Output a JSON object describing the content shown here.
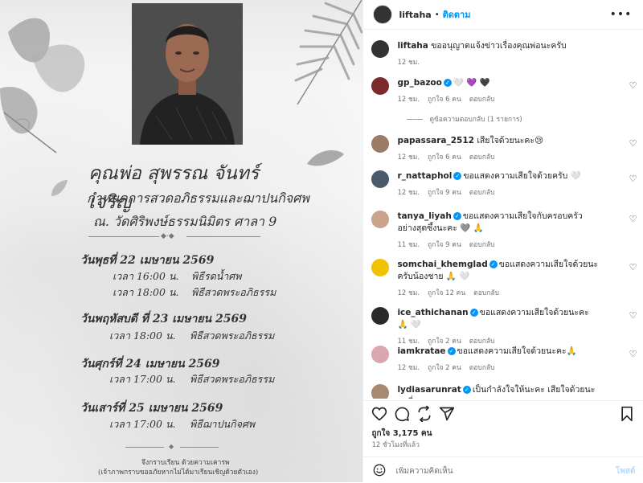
{
  "memorial": {
    "name": "คุณพ่อ สุพรรณ จันทร์เจริญ",
    "subtitle": "กำหนดการสวดอภิธรรมและฌาปนกิจศพ",
    "venue": "ณ. วัดศิริพงษ์ธรรมนิมิตร ศาลา 9",
    "schedule": [
      {
        "day": "วันพุธที่ 22 เมษายน 2569",
        "slots": [
          {
            "time": "เวลา 16:00 น.",
            "event": "พิธีรดน้ำศพ"
          },
          {
            "time": "เวลา 18:00 น.",
            "event": "พิธีสวดพระอภิธรรม"
          }
        ]
      },
      {
        "day": "วันพฤหัสบดี ที่ 23 เมษายน  2569",
        "slots": [
          {
            "time": "เวลา 18:00 น.",
            "event": "พิธีสวดพระอภิธรรม"
          }
        ]
      },
      {
        "day": "วันศุกร์ที่ 24 เมษายน 2569",
        "slots": [
          {
            "time": "เวลา 17:00 น.",
            "event": "พิธีสวดพระอภิธรรม"
          }
        ]
      },
      {
        "day": "วันเสาร์ที่ 25 เมษายน 2569",
        "slots": [
          {
            "time": "เวลา 17:00 น.",
            "event": "พิธีฌาปนกิจศพ"
          }
        ]
      }
    ],
    "closing_line1": "จึงกราบเรียน ด้วยความเคารพ",
    "closing_line2": "(เจ้าภาพกราบขออภัยหากไม่ได้มาเรียนเชิญด้วยตัวเอง)"
  },
  "header": {
    "username": "liftaha",
    "separator": "•",
    "follow_label": "ติดตาม",
    "more_label": "•••"
  },
  "caption": {
    "username": "liftaha",
    "text": "ขออนุญาตแจ้งข่าวเรื่องคุณพ่อนะครับ",
    "time": "12 ชม."
  },
  "comments": [
    {
      "username": "gp_bazoo",
      "verified": true,
      "text": "🤍 💜 🖤",
      "time": "12 ชม.",
      "likes": "ถูกใจ 6 คน",
      "reply": "ตอบกลับ",
      "avatar_color": "#7a2a2a"
    },
    {
      "username": "papassara_2512",
      "verified": false,
      "text": "เสียใจด้วยนะคะ😢",
      "time": "12 ชม.",
      "likes": "ถูกใจ 6 คน",
      "reply": "ตอบกลับ",
      "avatar_color": "#9b7b66"
    },
    {
      "username": "r_nattaphol",
      "verified": true,
      "text": "ขอแสดงความเสียใจด้วยครับ 🤍",
      "time": "12 ชม.",
      "likes": "ถูกใจ 9 คน",
      "reply": "ตอบกลับ",
      "avatar_color": "#4a5a6a"
    },
    {
      "username": "tanya_liyah",
      "verified": true,
      "text": "ขอแสดงความเสียใจกับครอบครัวอย่างสุดซึ้งนะคะ 🩶 🙏",
      "time": "11 ชม.",
      "likes": "ถูกใจ 9 คน",
      "reply": "ตอบกลับ",
      "avatar_color": "#c9a48a"
    },
    {
      "username": "somchai_khemglad",
      "verified": true,
      "text": "ขอแสดงความเสียใจด้วยนะครับน้องชาย 🙏 🤍",
      "time": "12 ชม.",
      "likes": "ถูกใจ 12 คน",
      "reply": "ตอบกลับ",
      "avatar_color": "#f2c200"
    },
    {
      "username": "ice_athichanan",
      "verified": true,
      "text": "ขอแสดงความเสียใจด้วยนะคะ 🙏 🤍",
      "time": "11 ชม.",
      "likes": "ถูกใจ 2 คน",
      "reply": "ตอบกลับ",
      "avatar_color": "#2a2a2a"
    },
    {
      "username": "iamkratae",
      "verified": true,
      "text": "ขอแสดงความเสียใจด้วยนะคะ🙏",
      "time": "12 ชม.",
      "likes": "ถูกใจ 2 คน",
      "reply": "ตอบกลับ",
      "avatar_color": "#d9a7b0"
    },
    {
      "username": "lydiasarunrat",
      "verified": true,
      "text": "เป็นกำลังใจให้นะคะ เสียใจด้วยนะคะพี่",
      "time": "",
      "likes": "",
      "reply": "",
      "avatar_color": "#a8896f"
    }
  ],
  "view_replies": "ดูข้อความตอบกลับ (1 รายการ)",
  "actions": {
    "like_icon": "heart-icon",
    "comment_icon": "comment-icon",
    "share_icon": "share-icon",
    "send_icon": "send-icon",
    "save_icon": "bookmark-icon"
  },
  "likes_text": "ถูกใจ 3,175 คน",
  "time_ago": "12 ชั่วโมงที่แล้ว",
  "add_comment": {
    "placeholder": "เพิ่มความคิดเห็น",
    "post_label": "โพสต์"
  }
}
